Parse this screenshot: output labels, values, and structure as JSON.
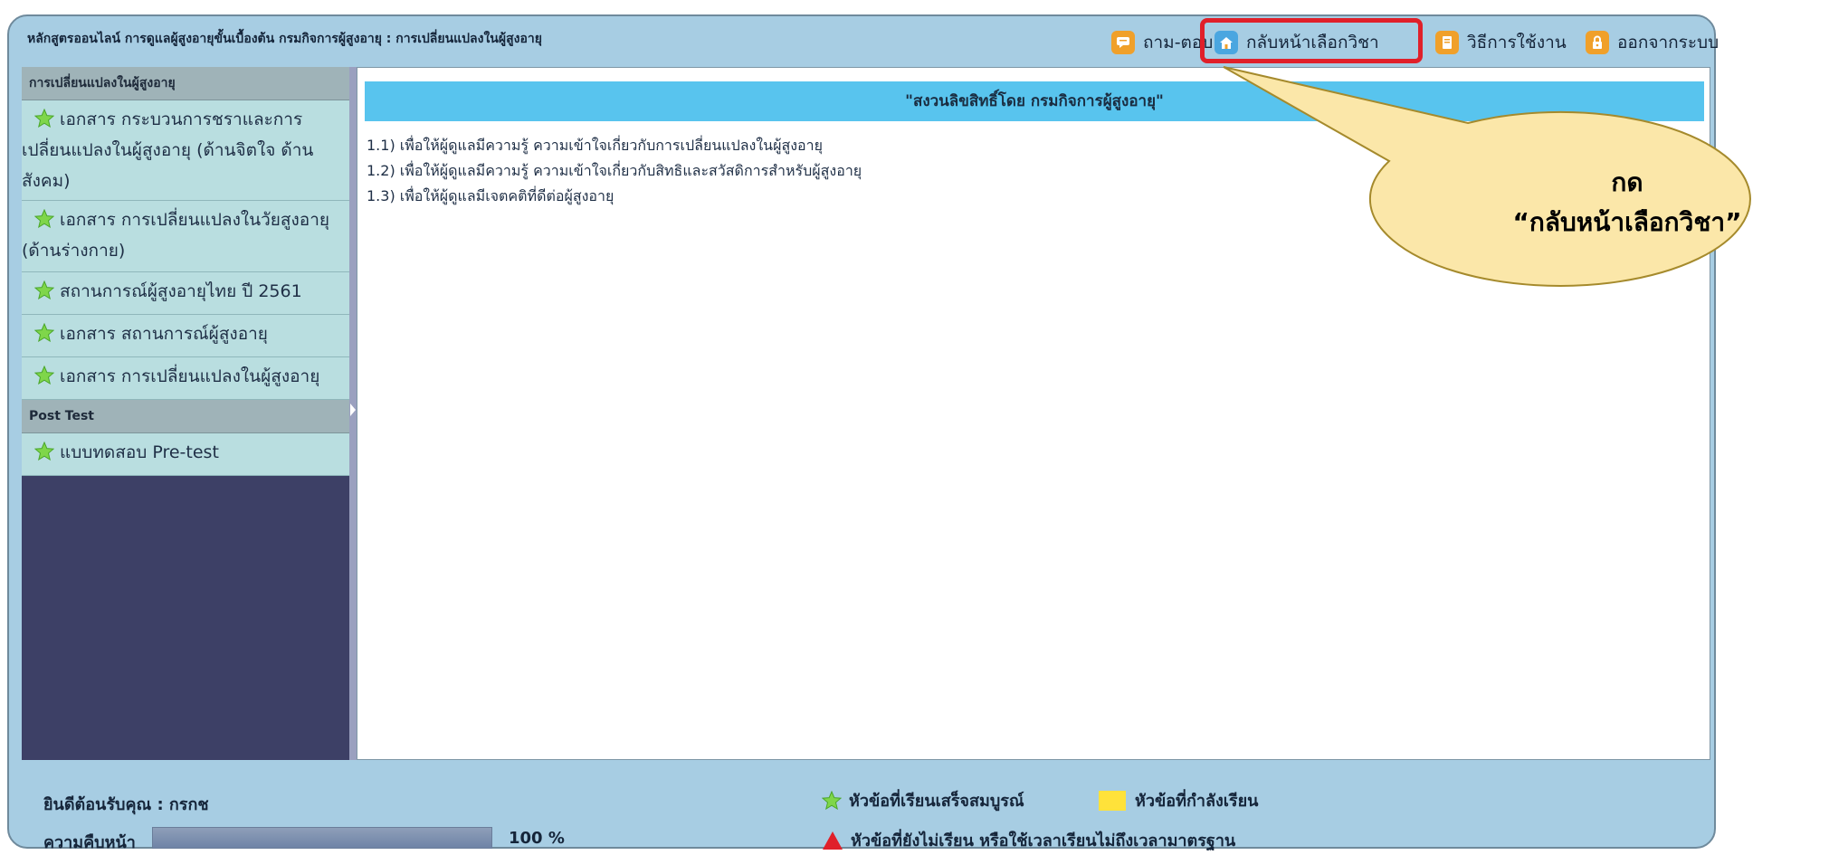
{
  "header": {
    "course_title": "หลักสูตรออนไลน์ การดูแลผู้สูงอายุขั้นเบื้องต้น กรมกิจการผู้สูงอายุ : การเปลี่ยนแปลงในผู้สูงอายุ",
    "nav": [
      {
        "label": "ถาม-ตอบ",
        "icon": "chat-icon"
      },
      {
        "label": "กลับหน้าเลือกวิชา",
        "icon": "home-icon"
      },
      {
        "label": "วิธีการใช้งาน",
        "icon": "help-icon"
      },
      {
        "label": "ออกจากระบบ",
        "icon": "lock-icon"
      }
    ]
  },
  "sidebar": {
    "section1": "การเปลี่ยนแปลงในผู้สูงอายุ",
    "items": [
      {
        "label": "เอกสาร กระบวนการชราและการเปลี่ยนแปลงในผู้สูงอายุ (ด้านจิตใจ ด้านสังคม)"
      },
      {
        "label": "เอกสาร การเปลี่ยนแปลงในวัยสูงอายุ (ด้านร่างกาย)"
      },
      {
        "label": "สถานการณ์ผู้สูงอายุไทย ปี 2561"
      },
      {
        "label": "เอกสาร สถานการณ์ผู้สูงอายุ"
      },
      {
        "label": "เอกสาร การเปลี่ยนแปลงในผู้สูงอายุ"
      }
    ],
    "section2": "Post Test",
    "items2": [
      {
        "label": "แบบทดสอบ Pre-test"
      }
    ]
  },
  "content": {
    "banner": "\"สงวนลิขสิทธิ์โดย กรมกิจการผู้สูงอายุ\"",
    "objectives": [
      "1.1) เพื่อให้ผู้ดูแลมีความรู้ ความเข้าใจเกี่ยวกับการเปลี่ยนแปลงในผู้สูงอายุ",
      "1.2) เพื่อให้ผู้ดูแลมีความรู้ ความเข้าใจเกี่ยวกับสิทธิและสวัสดิการสำหรับผู้สูงอายุ",
      "1.3) เพื่อให้ผู้ดูแลมีเจตคติที่ดีต่อผู้สูงอายุ"
    ]
  },
  "callout": {
    "line1": "กด",
    "line2": "“กลับหน้าเลือกวิชา”"
  },
  "footer": {
    "welcome": "ยินดีต้อนรับคุณ : กรกช",
    "progress_label": "ความคืบหน้า",
    "progress_percent": 100,
    "progress_text": "100 %",
    "legend": {
      "completed": "หัวข้อที่เรียนเสร็จสมบูรณ์",
      "in_progress": "หัวข้อที่กำลังเรียน",
      "not_studied": "หัวข้อที่ยังไม่เรียน หรือใช้เวลาเรียนไม่ถึงเวลามาตรฐาน"
    }
  },
  "colors": {
    "frame_bg": "#a7cde3",
    "sidebar_bg": "#3d4066",
    "sidebar_item_bg": "#b9dee0",
    "banner_bg": "#58c4ee",
    "accent_orange": "#f0a02a",
    "highlight_red": "#e0202a",
    "callout_fill": "#fbe7a9"
  }
}
